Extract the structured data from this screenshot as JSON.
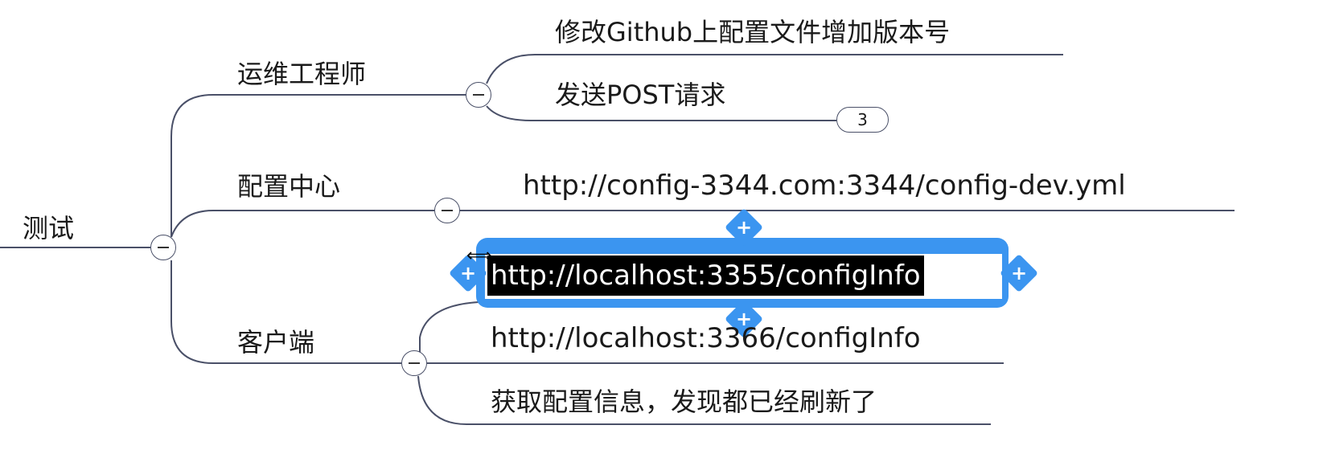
{
  "root": {
    "label": "测试"
  },
  "branches": [
    {
      "label": "运维工程师",
      "children": [
        "修改Github上配置文件增加版本号",
        "发送POST请求"
      ],
      "badge": "3"
    },
    {
      "label": "配置中心",
      "children": [
        "http://config-3344.com:3344/config-dev.yml"
      ]
    },
    {
      "label": "客户端",
      "children": [
        "http://localhost:3355/configInfo",
        "http://localhost:3366/configInfo",
        "获取配置信息，发现都已经刷新了"
      ]
    }
  ],
  "colors": {
    "line": "#4a5068",
    "selection": "#3b95f0"
  }
}
